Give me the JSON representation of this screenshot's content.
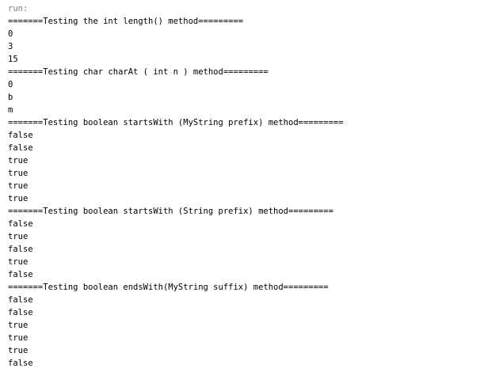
{
  "console": {
    "lines": [
      "run:",
      "=======Testing the int length() method=========",
      "0",
      "3",
      "15",
      "=======Testing char charAt ( int n ) method=========",
      "0",
      "b",
      "m",
      "=======Testing boolean startsWith (MyString prefix) method=========",
      "false",
      "false",
      "true",
      "true",
      "true",
      "true",
      "=======Testing boolean startsWith (String prefix) method=========",
      "false",
      "true",
      "false",
      "true",
      "false",
      "=======Testing boolean endsWith(MyString suffix) method=========",
      "false",
      "false",
      "true",
      "true",
      "true",
      "false"
    ]
  }
}
